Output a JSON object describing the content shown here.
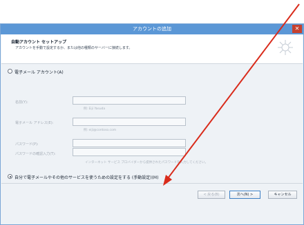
{
  "window": {
    "title": "アカウントの追加",
    "close_glyph": "✕"
  },
  "header": {
    "title": "自動アカウント セットアップ",
    "subtitle": "アカウントを手動で設定するか、または他の種類のサーバーに接続します。"
  },
  "options": {
    "email_account_label": "電子メール アカウント(A)",
    "manual_setup_label": "自分で電子メールやその他のサービスを使うための設定をする (手動設定)(M)"
  },
  "form": {
    "name_label": "名前(Y):",
    "name_hint": "例: Eiji Yasuda",
    "email_label": "電子メール アドレス(E):",
    "email_hint": "例: eiji@contoso.com",
    "password_label": "パスワード(P):",
    "password_confirm_label": "パスワードの確認入力(T):",
    "password_note": "インターネット サービス プロバイダーから提供されたパスワードを入力してください。"
  },
  "buttons": {
    "back": "< 戻る(B)",
    "next": "次へ(N) >",
    "cancel": "キャンセル"
  },
  "colors": {
    "titlebar": "#5b97d6",
    "close": "#c6412f",
    "annotation_arrow": "#d92b1b"
  }
}
